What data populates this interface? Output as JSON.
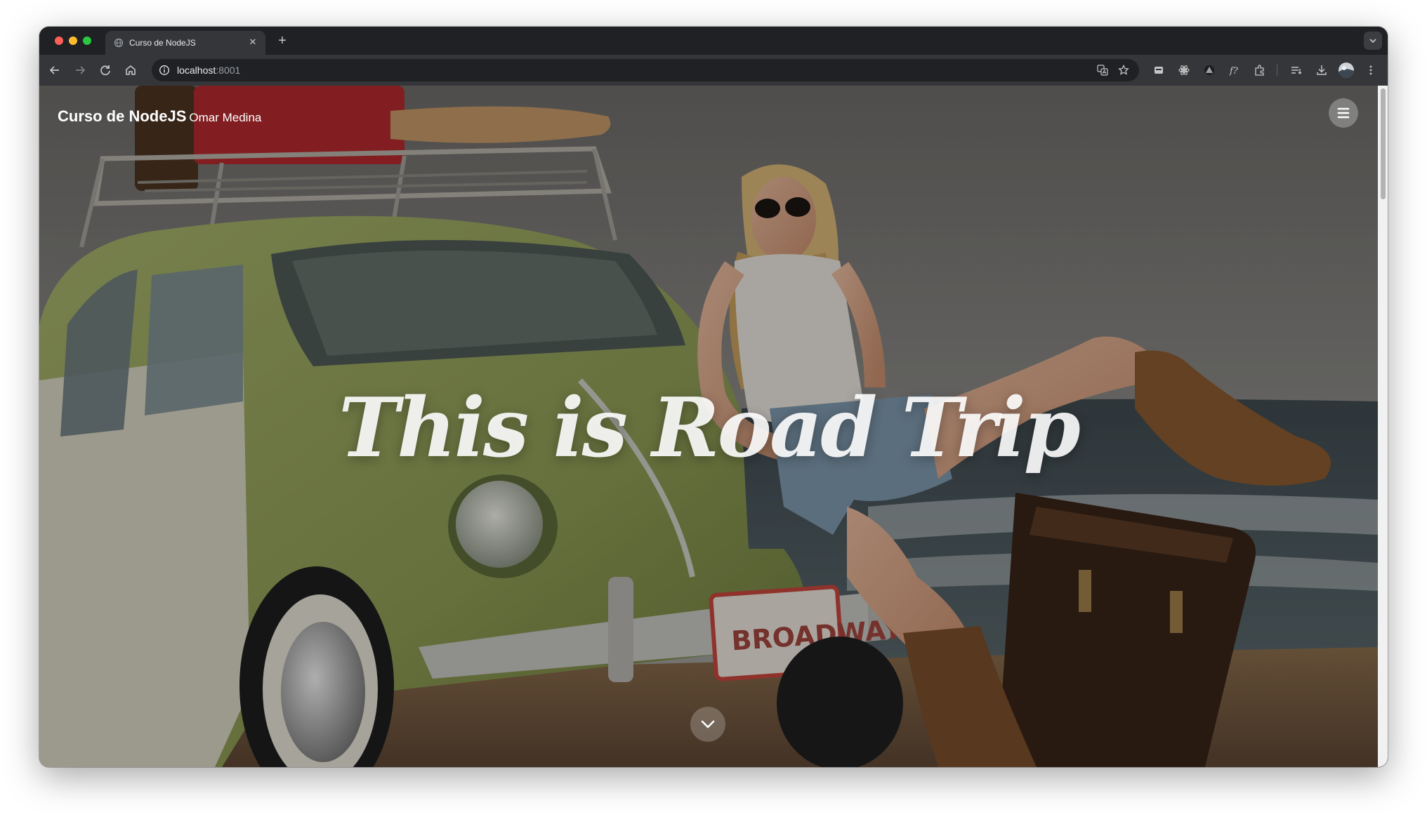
{
  "browser": {
    "tab": {
      "title": "Curso de NodeJS"
    },
    "address_bar": {
      "host": "localhost",
      "port": ":8001"
    }
  },
  "page": {
    "brand": {
      "title": "Curso de NodeJS",
      "subtitle": "Omar Medina"
    },
    "hero": {
      "headline": "This is Road Trip"
    },
    "plate_text": "BROADWAY"
  },
  "colors": {
    "tab_strip": "#202124",
    "toolbar": "#35363a",
    "car_green": "#8a9a52",
    "sky": "#8b8b88"
  },
  "icons": [
    "close-icon",
    "plus-icon",
    "chevron-down-icon",
    "back-arrow-icon",
    "forward-arrow-icon",
    "reload-icon",
    "home-icon",
    "info-icon",
    "translate-icon",
    "star-icon",
    "extension-icon",
    "downloads-icon",
    "more-vert-icon",
    "hamburger-menu-icon"
  ]
}
